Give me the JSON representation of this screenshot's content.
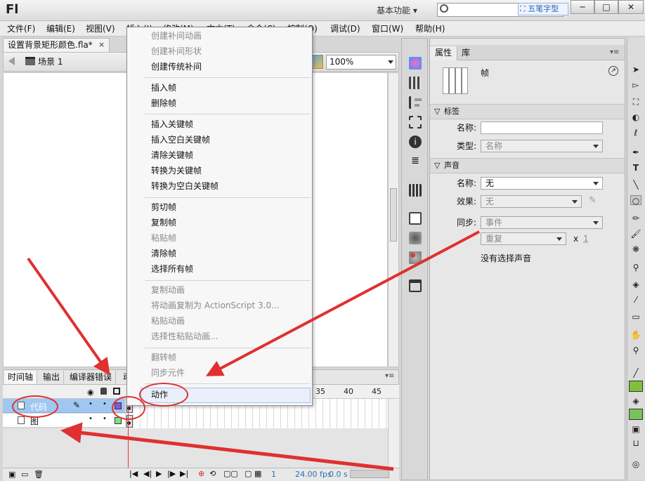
{
  "app": {
    "logo": "Fl",
    "workspace": "基本功能",
    "ime_badge": "五笔字型"
  },
  "window_buttons": {
    "minimize": "─",
    "maximize": "□",
    "close": "✕"
  },
  "menu": [
    "文件(F)",
    "编辑(E)",
    "视图(V)",
    "插入(I)",
    "修改(M)",
    "文本(T)",
    "命令(C)",
    "控制(O)",
    "调试(D)",
    "窗口(W)",
    "帮助(H)"
  ],
  "document": {
    "tab_label": "设置背景矩形颜色.fla*",
    "close": "×",
    "scene": "场景 1",
    "zoom": "100%"
  },
  "timeline": {
    "tabs": [
      "时间轴",
      "输出",
      "编译器错误",
      "动"
    ],
    "ruler": [
      "35",
      "40",
      "45"
    ],
    "layers": [
      {
        "name": "代码"
      },
      {
        "name": "图"
      }
    ],
    "status": {
      "frame": "1",
      "fps": "24.00 fps",
      "time": "0.0 s"
    }
  },
  "properties": {
    "tabs": [
      "属性",
      "库"
    ],
    "title": "帧",
    "label_section": "标签",
    "name_label": "名称:",
    "name_value": "",
    "type_label": "类型:",
    "type_value": "名称",
    "sound_section": "声音",
    "sound_name_label": "名称:",
    "sound_name_value": "无",
    "effect_label": "效果:",
    "effect_value": "无",
    "sync_label": "同步:",
    "sync_value": "事件",
    "repeat_value": "重复",
    "repeat_x": "x",
    "repeat_count": "1",
    "no_sound": "没有选择声音"
  },
  "context_menu": {
    "items": [
      {
        "label": "创建补间动画",
        "enabled": false
      },
      {
        "label": "创建补间形状",
        "enabled": false
      },
      {
        "label": "创建传统补间",
        "enabled": true
      },
      {
        "label": "插入帧",
        "enabled": true
      },
      {
        "label": "删除帧",
        "enabled": true
      },
      {
        "label": "插入关键帧",
        "enabled": true
      },
      {
        "label": "插入空白关键帧",
        "enabled": true
      },
      {
        "label": "清除关键帧",
        "enabled": true
      },
      {
        "label": "转换为关键帧",
        "enabled": true
      },
      {
        "label": "转换为空白关键帧",
        "enabled": true
      },
      {
        "label": "剪切帧",
        "enabled": true
      },
      {
        "label": "复制帧",
        "enabled": true
      },
      {
        "label": "粘贴帧",
        "enabled": false
      },
      {
        "label": "清除帧",
        "enabled": true
      },
      {
        "label": "选择所有帧",
        "enabled": true
      },
      {
        "label": "复制动画",
        "enabled": false
      },
      {
        "label": "将动画复制为 ActionScript 3.0...",
        "enabled": false
      },
      {
        "label": "粘贴动画",
        "enabled": false
      },
      {
        "label": "选择性粘贴动画...",
        "enabled": false
      },
      {
        "label": "翻转帧",
        "enabled": false
      },
      {
        "label": "同步元件",
        "enabled": false
      },
      {
        "label": "动作",
        "enabled": true,
        "highlighted": true
      }
    ]
  },
  "colors": {
    "annotation": "#e03030",
    "layer_selected": "#9fc7f1",
    "keyframe_purple": "#8a55d6",
    "keyframe_green": "#7ee37e",
    "accent_link": "#2f6fb3"
  }
}
